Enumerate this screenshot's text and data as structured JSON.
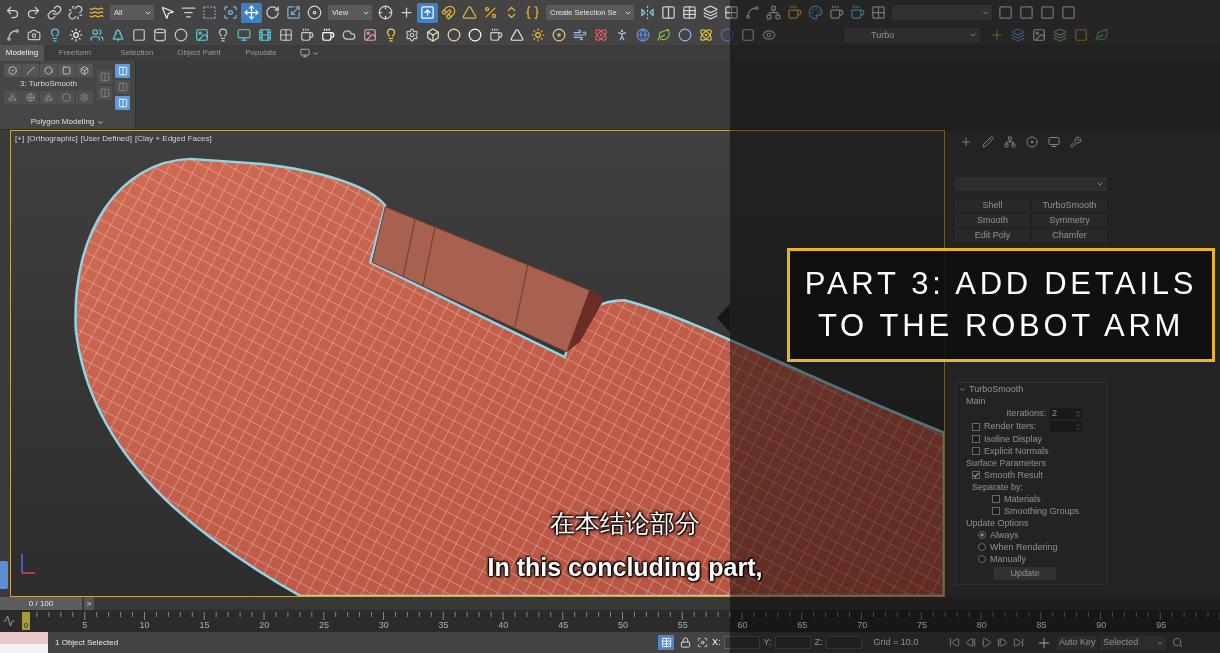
{
  "main_toolbar": [
    {
      "kind": "tool",
      "selected": false
    },
    {
      "kind": "tool",
      "selected": false
    },
    {
      "kind": "tool",
      "selected": false
    },
    {
      "kind": "tool",
      "selected": false
    },
    {
      "kind": "tool",
      "selected": false
    },
    {
      "kind": "dropdown",
      "value": "All"
    },
    {
      "kind": "tool",
      "selected": false
    },
    {
      "kind": "tool",
      "selected": false
    },
    {
      "kind": "tool",
      "selected": false
    },
    {
      "kind": "tool",
      "selected": false
    },
    {
      "kind": "tool",
      "selected": true
    },
    {
      "kind": "tool",
      "selected": false
    },
    {
      "kind": "tool",
      "selected": false
    },
    {
      "kind": "tool",
      "selected": false
    },
    {
      "kind": "dropdown",
      "value": "View"
    },
    {
      "kind": "tool",
      "selected": false
    },
    {
      "kind": "tool",
      "selected": false
    },
    {
      "kind": "tool",
      "selected": true
    },
    {
      "kind": "tool",
      "selected": false
    },
    {
      "kind": "tool",
      "selected": false
    },
    {
      "kind": "tool",
      "selected": false
    },
    {
      "kind": "tool",
      "selected": false
    },
    {
      "kind": "tool",
      "selected": false
    },
    {
      "kind": "dropdown",
      "value": "Create Selection Se"
    },
    {
      "kind": "tool",
      "selected": false
    },
    {
      "kind": "tool",
      "selected": false
    },
    {
      "kind": "tool",
      "selected": false
    },
    {
      "kind": "tool",
      "selected": false
    },
    {
      "kind": "tool",
      "selected": false
    },
    {
      "kind": "tool",
      "selected": false
    },
    {
      "kind": "tool",
      "selected": false
    },
    {
      "kind": "tool",
      "selected": false
    },
    {
      "kind": "tool",
      "selected": false
    },
    {
      "kind": "tool",
      "selected": false
    },
    {
      "kind": "tool",
      "selected": false
    },
    {
      "kind": "tool",
      "selected": false
    },
    {
      "kind": "dropdown"
    },
    {
      "kind": "tool",
      "selected": false
    },
    {
      "kind": "tool",
      "selected": false
    },
    {
      "kind": "tool",
      "selected": false
    },
    {
      "kind": "tool",
      "selected": false
    }
  ],
  "command_toolbar": {
    "modifier_dropdown": "Turbo"
  },
  "ribbon": {
    "tabs": [
      {
        "label": "Modeling",
        "selected": true
      },
      {
        "label": "Freeform",
        "selected": false
      },
      {
        "label": "Selection",
        "selected": false
      },
      {
        "label": "Object Paint",
        "selected": false
      },
      {
        "label": "Populate",
        "selected": false
      }
    ],
    "panel": {
      "modifier": "3: TurboSmooth",
      "title": "Polygon Modeling",
      "side_tools": [
        {
          "selected": false
        },
        {
          "selected": false
        },
        {
          "selected": true
        },
        {
          "selected": false
        },
        {
          "selected": true
        }
      ]
    }
  },
  "viewport": {
    "active": true,
    "labels": [
      "[+]",
      "[Orthographic]",
      "[User Defined]",
      "[Clay + Edged Faces]"
    ]
  },
  "command_panel": {
    "modifier_buttons": [
      "Shell",
      "TurboSmooth",
      "Smooth",
      "Symmetry",
      "Edit Poly",
      "Chamfer"
    ],
    "rollout": {
      "title": "TurboSmooth",
      "expanded": true,
      "items": [
        {
          "kind": "group",
          "text": "Main"
        },
        {
          "kind": "spinner",
          "text": "Iterations:",
          "value": "2"
        },
        {
          "kind": "check_spinner",
          "text": "Render Iters:",
          "checked": false
        },
        {
          "kind": "checkbox",
          "text": "Isoline Display",
          "checked": false
        },
        {
          "kind": "checkbox",
          "text": "Explicit Normals",
          "checked": false
        },
        {
          "kind": "group",
          "text": "Surface Parameters"
        },
        {
          "kind": "checkbox",
          "text": "Smooth Result",
          "checked": true
        },
        {
          "kind": "label",
          "text": "Separate by:",
          "children": [
            {
              "kind": "checkbox",
              "text": "Materials",
              "checked": false
            },
            {
              "kind": "checkbox",
              "text": "Smoothing Groups",
              "checked": false
            }
          ]
        },
        {
          "kind": "group",
          "text": "Update Options"
        },
        {
          "kind": "radio",
          "text": "Always",
          "selected": true
        },
        {
          "kind": "radio",
          "text": "When Rendering",
          "selected": false
        },
        {
          "kind": "radio",
          "text": "Manually",
          "selected": false
        },
        {
          "kind": "button",
          "text": "Update"
        }
      ]
    }
  },
  "time_slider": {
    "position": "0 / 100",
    "next": ">",
    "current_frame": "0",
    "level": 0,
    "labels": [
      "5",
      "10",
      "15",
      "20",
      "25",
      "30",
      "35",
      "40",
      "45",
      "50",
      "55",
      "60",
      "65",
      "70",
      "75",
      "80",
      "85",
      "90",
      "95"
    ]
  },
  "status_bar": {
    "message": "1 Object Selected",
    "isolate": {
      "selected": true
    },
    "coordinates": [
      "X:",
      "Y:",
      "Z:"
    ],
    "grid": "Grid = 10.0",
    "auto_key": "Auto Key",
    "key_filter": "Selected"
  },
  "title_card": {
    "lines": [
      "PART 3: ADD DETAILS",
      "TO THE ROBOT ARM"
    ]
  },
  "subtitles": [
    "在本结论部分",
    "In this concluding part,"
  ]
}
